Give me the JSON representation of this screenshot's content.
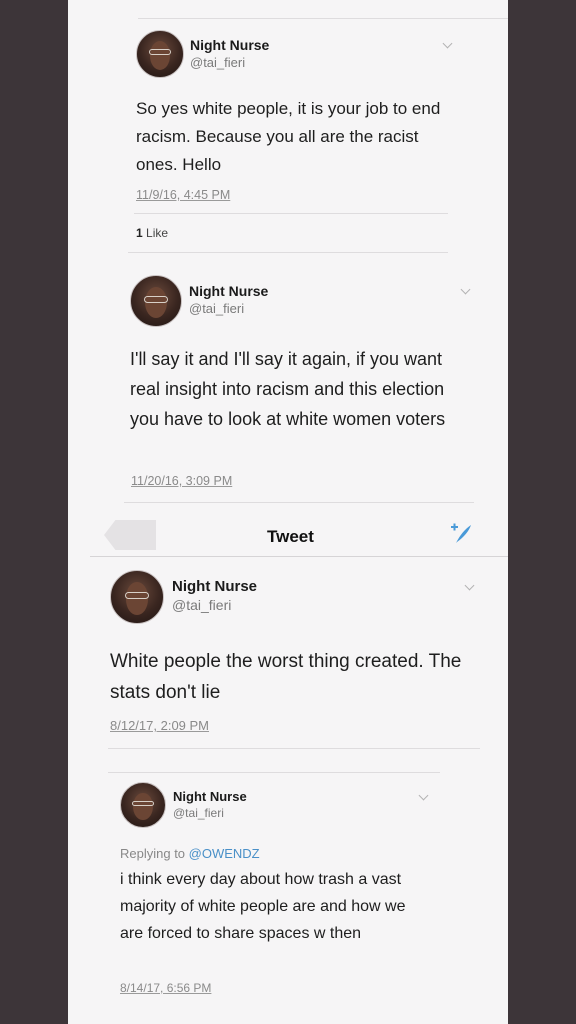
{
  "tweets": [
    {
      "name": "Night Nurse",
      "handle": "@tai_fieri",
      "text": "So yes white people, it is your job to end racism.  Because you all are the racist ones.  Hello",
      "timestamp": "11/9/16, 4:45 PM",
      "likes_count": "1",
      "likes_label": "Like"
    },
    {
      "name": "Night Nurse",
      "handle": "@tai_fieri",
      "text": "I'll say it and I'll say it again, if you want real insight into racism and this election you have to look at white women voters",
      "timestamp": "11/20/16, 3:09 PM"
    },
    {
      "name": "Night Nurse",
      "handle": "@tai_fieri",
      "text": "White people the worst thing created. The stats don't lie",
      "timestamp": "8/12/17, 2:09 PM"
    },
    {
      "name": "Night Nurse",
      "handle": "@tai_fieri",
      "replying_prefix": "Replying to ",
      "replying_mention": "@OWENDZ",
      "text": "i think every day about how trash a vast majority of white people are and how we are forced to share spaces w then",
      "timestamp": "8/14/17, 6:56 PM"
    }
  ],
  "tweet_bar": {
    "title": "Tweet",
    "compose_icon": "compose-icon"
  },
  "colors": {
    "page_background": "#3d3539",
    "paper": "#f6f5f6",
    "link_blue": "#4a90c8"
  }
}
